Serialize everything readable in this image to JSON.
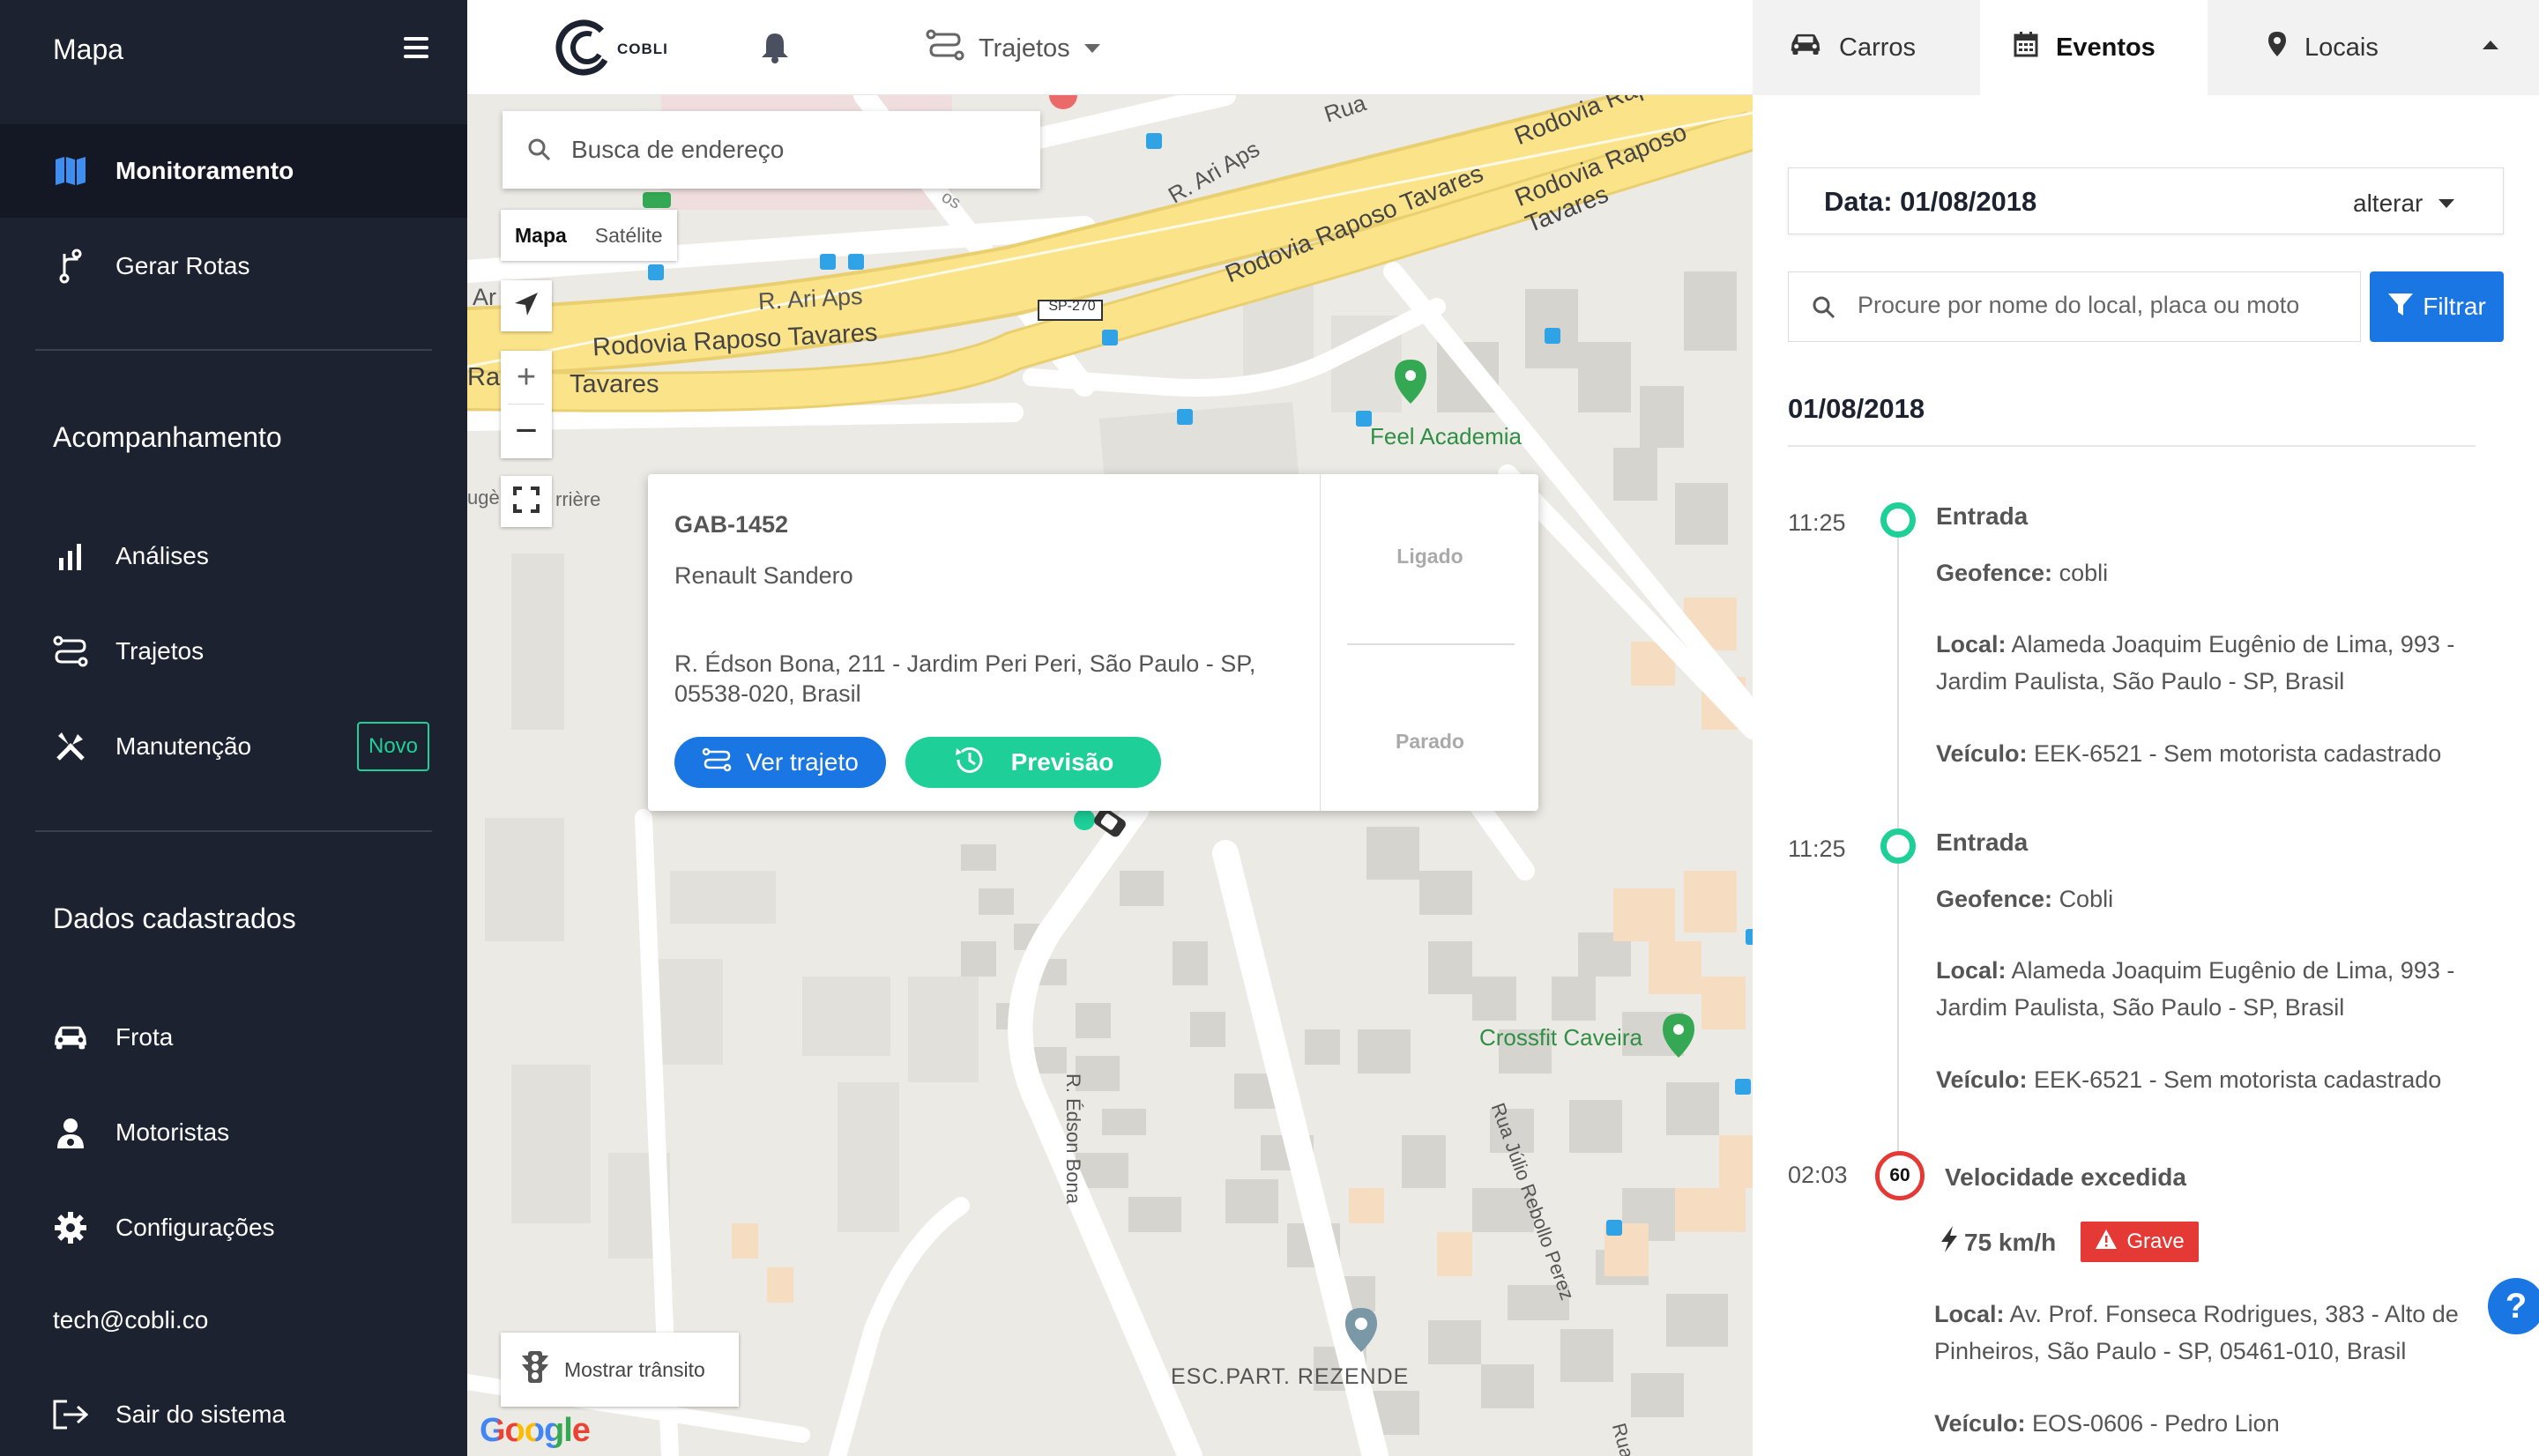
{
  "sidebar": {
    "title": "Mapa",
    "items_top": [
      {
        "label": "Monitoramento",
        "icon": "map-icon"
      },
      {
        "label": "Gerar Rotas",
        "icon": "route-icon"
      }
    ],
    "section_tracking": "Acompanhamento",
    "items_tracking": [
      {
        "label": "Análises",
        "icon": "bar-chart-icon"
      },
      {
        "label": "Trajetos",
        "icon": "trajectory-icon"
      },
      {
        "label": "Manutenção",
        "icon": "tools-icon",
        "badge": "Novo"
      }
    ],
    "section_data": "Dados cadastrados",
    "items_data": [
      {
        "label": "Frota",
        "icon": "car-icon"
      },
      {
        "label": "Motoristas",
        "icon": "driver-icon"
      },
      {
        "label": "Configurações",
        "icon": "gear-icon"
      }
    ],
    "email": "tech@cobli.co",
    "logout": "Sair do sistema"
  },
  "topbar": {
    "logo_text": "COBLI",
    "nav_dropdown": "Trajetos"
  },
  "map": {
    "search_placeholder": "Busca de endereço",
    "type_map": "Mapa",
    "type_satellite": "Satélite",
    "transit_button": "Mostrar trânsito",
    "google": "Google",
    "labels": {
      "rua": "Rua",
      "ari_aps_1": "R. Ari Aps",
      "ari_aps_2": "R. Ari Aps",
      "raposo_1": "Rodovia Raposo Tavares",
      "raposo_2": "Rodovia Raposo Tavares",
      "raposo_3": "Rodovia Raposo Tavares",
      "raposo_4": "Rodovia Raposo Tav",
      "sp270": "SP-270",
      "feel": "Feel Academia",
      "crossfit": "Crossfit Caveira",
      "edson": "R. Édson Bona",
      "julio": "Rua Júlio Rebollo Perez",
      "esc": "ESC.PART. REZENDE",
      "ar": "Ar",
      "ra": "Ra",
      "tavares": "Tavares",
      "riere": "rrière",
      "ug": "ugè",
      "rua_bottom": "Rua",
      "os": "os"
    },
    "popup": {
      "plate": "GAB-1452",
      "model": "Renault Sandero",
      "address": "R. Édson Bona, 211 - Jardim Peri Peri, São Paulo - SP, 05538-020, Brasil",
      "status_1": "Ligado",
      "status_2": "Parado",
      "btn_trajeto": "Ver trajeto",
      "btn_previsao": "Previsão"
    }
  },
  "panel": {
    "tabs": [
      "Carros",
      "Eventos",
      "Locais"
    ],
    "date_label": "Data: 01/08/2018",
    "date_change": "alterar",
    "filter_placeholder": "Procure por nome do local, placa ou moto",
    "filter_button": "Filtrar",
    "day_header": "01/08/2018",
    "events": [
      {
        "time": "11:25",
        "title": "Entrada",
        "geofence_label": "Geofence:",
        "geofence": "cobli",
        "local_label": "Local:",
        "local_1": "Alameda Joaquim Eugênio de Lima, 993 -",
        "local_2": "Jardim Paulista, São Paulo - SP, Brasil",
        "vehicle_label": "Veículo:",
        "vehicle": "EEK-6521 - Sem motorista cadastrado"
      },
      {
        "time": "11:25",
        "title": "Entrada",
        "geofence_label": "Geofence:",
        "geofence": "Cobli",
        "local_label": "Local:",
        "local_1": "Alameda Joaquim Eugênio de Lima, 993 -",
        "local_2": "Jardim Paulista, São Paulo - SP, Brasil",
        "vehicle_label": "Veículo:",
        "vehicle": "EEK-6521 - Sem motorista cadastrado"
      },
      {
        "time": "02:03",
        "title": "Velocidade excedida",
        "speed_limit": "60",
        "speed": "75 km/h",
        "severity": "Grave",
        "local_label": "Local:",
        "local_1": "Av. Prof. Fonseca Rodrigues, 383 - Alto de",
        "local_2": "Pinheiros, São Paulo - SP, 05461-010, Brasil",
        "vehicle_label": "Veículo:",
        "vehicle": "EOS-0606 - Pedro Lion"
      }
    ],
    "help": "?"
  },
  "colors": {
    "sidebar_bg": "#1d2230",
    "accent_blue": "#1976e3",
    "accent_green": "#1ecf97",
    "alert_red": "#e53935",
    "highway_yellow": "#fbe38a"
  }
}
